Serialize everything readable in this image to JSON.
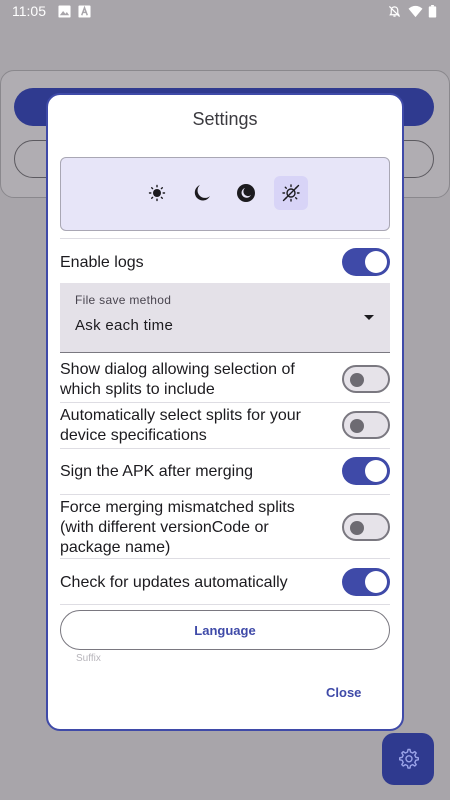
{
  "status_bar": {
    "time": "11:05",
    "left_icons": [
      "image-icon",
      "font-icon"
    ],
    "right_icons": [
      "notifications-off-icon",
      "wifi-icon",
      "battery-icon"
    ]
  },
  "dialog": {
    "title": "Settings",
    "theme_options": [
      {
        "icon": "sun-icon",
        "selected": false
      },
      {
        "icon": "moon-icon",
        "selected": false
      },
      {
        "icon": "moon-circle-icon",
        "selected": false
      },
      {
        "icon": "auto-theme-icon",
        "selected": true
      }
    ],
    "enable_logs": {
      "label": "Enable logs",
      "on": true
    },
    "file_save_method": {
      "label": "File save method",
      "value": "Ask each time"
    },
    "show_dialog_splits": {
      "label": "Show dialog allowing selection of which splits to include",
      "on": false
    },
    "auto_select_splits": {
      "label": "Automatically select splits for your device specifications",
      "on": false
    },
    "sign_apk": {
      "label": "Sign the APK after merging",
      "on": true
    },
    "force_merge": {
      "label": "Force merging mismatched splits (with different versionCode or package name)",
      "on": false
    },
    "check_updates": {
      "label": "Check for updates automatically",
      "on": true
    },
    "language_button": "Language",
    "faded_text": "Suffix",
    "close_button": "Close"
  },
  "colors": {
    "accent": "#3f4aa8",
    "scrim": "#a8a5aa",
    "theme_box": "#e7e5f8"
  }
}
